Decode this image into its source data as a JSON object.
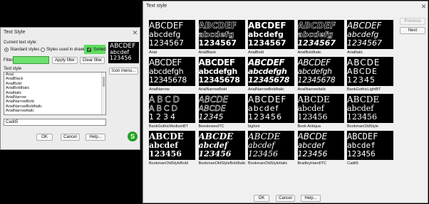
{
  "left_dialog": {
    "title": "Text Style",
    "current_label": "Current text style:",
    "radio_standard": "Standard styles",
    "radio_used": "Styles used in drawing",
    "sorted_label": "Sorted",
    "filter_label": "Filter",
    "filter_value": "",
    "apply_filter": "Apply filter",
    "clear_filter": "Clear filter",
    "icon_menu": "Icon menu...",
    "text_style_label": "Text style",
    "styles": [
      "Arial",
      "ArialBlack",
      "ArialBold",
      "ArialBoldItalic",
      "ArialItalic",
      "ArialNarrow",
      "ArialNarrowBold",
      "ArialNarrowBoldItalic",
      "ArialNarrowItalic"
    ],
    "selected_value": "Cadit5",
    "ok": "OK",
    "cancel": "Cancel",
    "help": "Help...",
    "preview_lines": [
      "ABCDEF",
      "abcdef",
      "123456"
    ],
    "colors": {
      "highlight": "#5fdc5f",
      "badge": "#22a322"
    }
  },
  "right_dialog": {
    "title": "Text style",
    "previous": "Previous",
    "next": "Next",
    "ok": "OK",
    "cancel": "Cancel",
    "help": "Help...",
    "tiles": [
      {
        "name": "Arial",
        "l1": "ABCDEF",
        "l2": "abcdefg",
        "l3": "1234567"
      },
      {
        "name": "ArialBlack",
        "l1": "ABCDEF",
        "l2": "abcdefg",
        "l3": "1234567"
      },
      {
        "name": "ArialBold",
        "l1": "ABCDEF",
        "l2": "abcdefg",
        "l3": "1234567"
      },
      {
        "name": "ArialBoldItalic",
        "l1": "ABCDEF",
        "l2": "abcdefg",
        "l3": "1234567"
      },
      {
        "name": "ArialItalic",
        "l1": "ABCDEF",
        "l2": "abcdefg",
        "l3": "1234567"
      },
      {
        "name": "ArialNarrow",
        "l1": "ABCDEF",
        "l2": "abcdefgh",
        "l3": "12345678"
      },
      {
        "name": "ArialNarrowBold",
        "l1": "ABCDEF",
        "l2": "abcdefgh",
        "l3": "12345678"
      },
      {
        "name": "ArialNarrowBoldItalic",
        "l1": "ABCDEF",
        "l2": "abcdefgh",
        "l3": "12345678"
      },
      {
        "name": "ArialNarrowItalic",
        "l1": "ABCDEF",
        "l2": "abcdefgh",
        "l3": "12345678"
      },
      {
        "name": "BankGothicLightBT",
        "l1": "ABCDE",
        "l2": "ABCDE",
        "l3": "12345"
      },
      {
        "name": "BankGothicMediumBT",
        "l1": "ABCD",
        "l2": "ABCD",
        "l3": "1234"
      },
      {
        "name": "BeeskneesITC",
        "l1": "ABCDE",
        "l2": "ABCDE",
        "l3": "12345"
      },
      {
        "name": "bigfont",
        "l1": "ABCDEF",
        "l2": "abcdef",
        "l3": "123456"
      },
      {
        "name": "Book Antiqua",
        "l1": "ABCDE",
        "l2": "abcdef",
        "l3": "123456"
      },
      {
        "name": "BookmanOldStyle",
        "l1": "ABCDE",
        "l2": "abcdef",
        "l3": "123456"
      },
      {
        "name": "BookmanOldStyleBold",
        "l1": "ABCDE",
        "l2": "abcdef",
        "l3": "123456"
      },
      {
        "name": "BookmanOldStyleBoldItalic",
        "l1": "ABCDE",
        "l2": "abcdef",
        "l3": "123456"
      },
      {
        "name": "BookmanOldStyleItalic",
        "l1": "ABCDE",
        "l2": "abcdef",
        "l3": "123456"
      },
      {
        "name": "BradleyHandITC",
        "l1": "ABCDE",
        "l2": "abcdef",
        "l3": "123456"
      },
      {
        "name": "Cadit5",
        "l1": "ABCDEF",
        "l2": "abcdef",
        "l3": "123456"
      }
    ]
  }
}
